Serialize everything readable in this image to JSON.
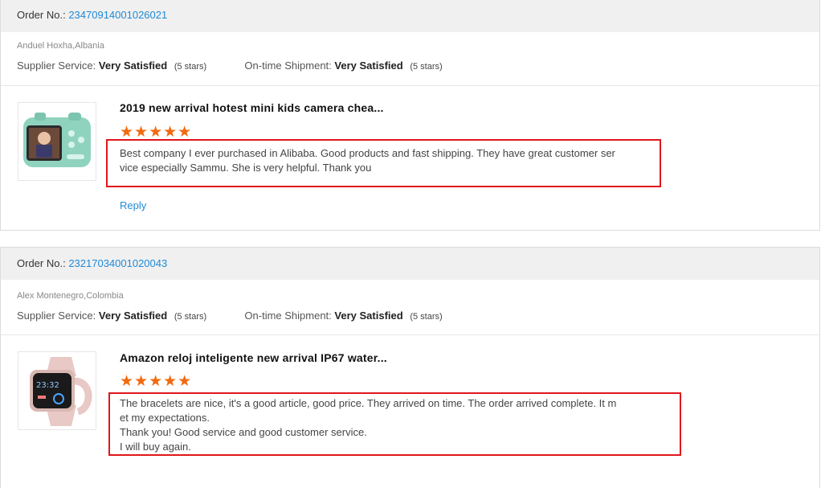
{
  "reviews": [
    {
      "order_label": "Order No.:",
      "order_no": "23470914001026021",
      "buyer": "Anduel Hoxha,Albania",
      "supplier_label": "Supplier Service:",
      "supplier_value": "Very Satisfied",
      "supplier_stars": "(5 stars)",
      "shipment_label": "On-time Shipment:",
      "shipment_value": "Very Satisfied",
      "shipment_stars": "(5 stars)",
      "product_title": "2019 new arrival hotest mini kids camera chea...",
      "stars": "★★★★★",
      "rating": 5,
      "text": "Best company I ever purchased in Alibaba. Good products and fast shipping. They have great customer ser\nvice especially Sammu. She is very helpful. Thank you",
      "reply_label": "Reply"
    },
    {
      "order_label": "Order No.:",
      "order_no": "23217034001020043",
      "buyer": "Alex Montenegro,Colombia",
      "supplier_label": "Supplier Service:",
      "supplier_value": "Very Satisfied",
      "supplier_stars": "(5 stars)",
      "shipment_label": "On-time Shipment:",
      "shipment_value": "Very Satisfied",
      "shipment_stars": "(5 stars)",
      "product_title": "Amazon reloj inteligente new arrival IP67 water...",
      "stars": "★★★★★",
      "rating": 5,
      "text": "The bracelets are nice, it's a good article, good price. They arrived on time. The order arrived complete. It m\net my expectations.\nThank you! Good service and good customer service.\nI will buy again."
    }
  ],
  "colors": {
    "link": "#1f8ad6",
    "star": "#f26a10",
    "highlight_border": "#e0161c",
    "header_bg": "#f0f0f0"
  }
}
